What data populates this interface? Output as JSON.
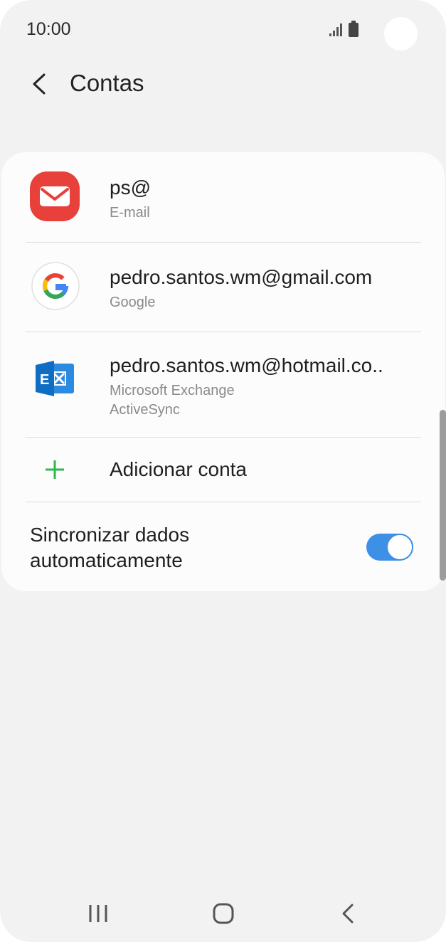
{
  "status_bar": {
    "time": "10:00",
    "icons": [
      "signal-icon",
      "battery-icon"
    ]
  },
  "header": {
    "back_icon": "chevron-left-icon",
    "title": "Contas"
  },
  "accounts": [
    {
      "primary": "ps@",
      "secondary": "E-mail",
      "icon": "email-app-icon",
      "icon_color": "#e8413c"
    },
    {
      "primary": "pedro.santos.wm@gmail.com",
      "secondary": "Google",
      "icon": "google-icon"
    },
    {
      "primary": "pedro.santos.wm@hotmail.co..",
      "secondary_lines": [
        "Microsoft Exchange",
        "ActiveSync"
      ],
      "icon": "exchange-icon",
      "icon_color": "#0f6ec4"
    }
  ],
  "add_account": {
    "label": "Adicionar conta",
    "icon": "plus-icon",
    "icon_color": "#2eb84b"
  },
  "sync": {
    "label_lines": [
      "Sincronizar dados",
      "automaticamente"
    ],
    "enabled": true,
    "accent": "#3e8fe6"
  },
  "nav_bar": {
    "buttons": [
      "recent-apps-icon",
      "home-icon",
      "back-icon"
    ]
  }
}
